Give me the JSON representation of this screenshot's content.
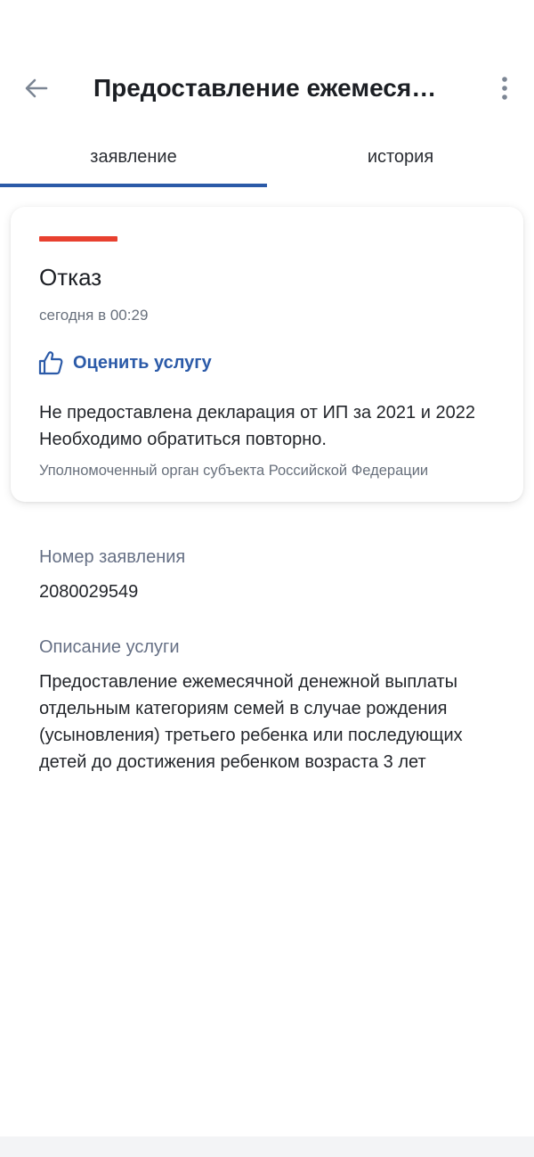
{
  "header": {
    "title": "Предоставление ежемеся…",
    "back_icon": "arrow-left-icon",
    "more_icon": "more-vertical-icon"
  },
  "tabs": [
    {
      "label": "заявление",
      "active": true
    },
    {
      "label": "история",
      "active": false
    }
  ],
  "status_card": {
    "status": "Отказ",
    "status_color": "#e8402f",
    "time": "сегодня в 00:29",
    "rate_label": "Оценить услугу",
    "rate_icon": "thumbs-up-icon",
    "message": "Не предоставлена декларация от ИП за 2021 и 2022 Необходимо обратиться повторно.",
    "organization": "Уполномоченный орган субъекта Российской Федерации"
  },
  "application": {
    "number_label": "Номер заявления",
    "number_value": "2080029549",
    "description_label": "Описание услуги",
    "description_value": "Предоставление ежемесячной денежной выплаты отдельным категориям семей в случае рождения (усыновления) третьего ребенка или последующих детей до достижения ребенком возраста 3 лет"
  },
  "colors": {
    "accent": "#2b5aa8",
    "status_refused": "#e8402f",
    "muted_text": "#68707c"
  }
}
